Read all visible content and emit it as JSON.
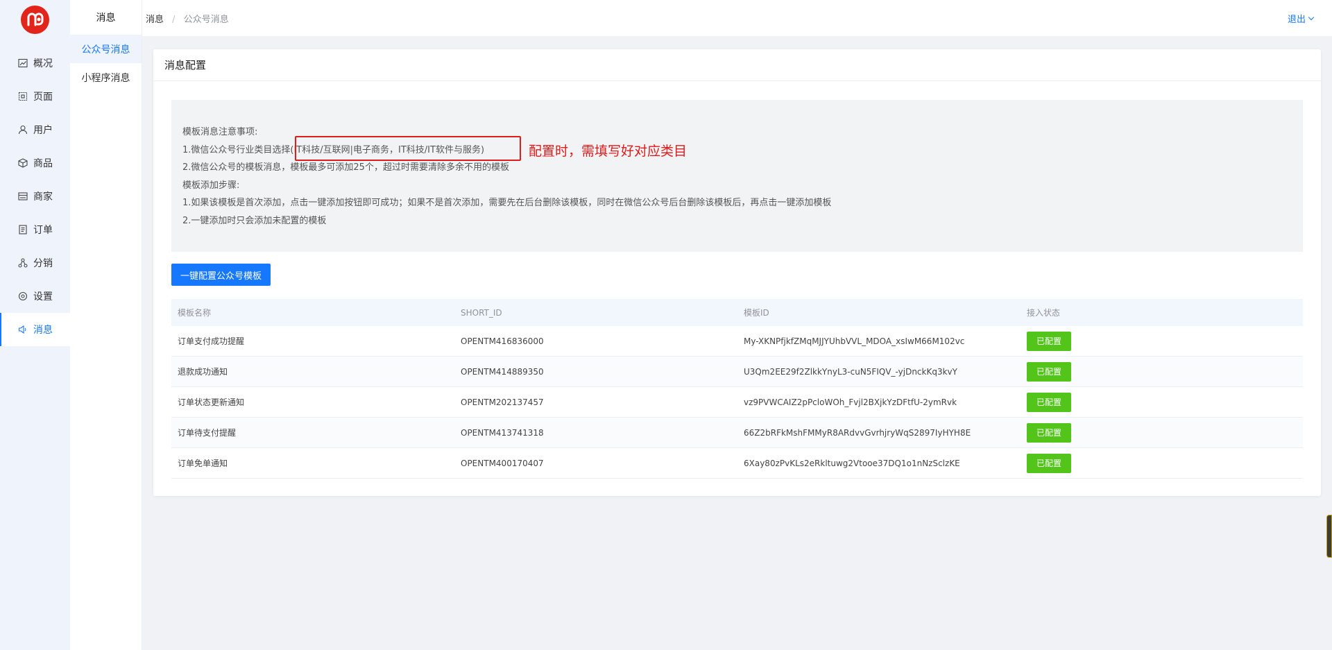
{
  "sidebar": {
    "items": [
      {
        "label": "概况",
        "icon": "chart-icon"
      },
      {
        "label": "页面",
        "icon": "page-icon"
      },
      {
        "label": "用户",
        "icon": "user-icon"
      },
      {
        "label": "商品",
        "icon": "box-icon"
      },
      {
        "label": "商家",
        "icon": "store-icon"
      },
      {
        "label": "订单",
        "icon": "order-icon"
      },
      {
        "label": "分销",
        "icon": "distribution-icon"
      },
      {
        "label": "设置",
        "icon": "settings-icon"
      },
      {
        "label": "消息",
        "icon": "message-icon"
      }
    ],
    "active_index": 8
  },
  "subsidebar": {
    "title": "消息",
    "items": [
      {
        "label": "公众号消息"
      },
      {
        "label": "小程序消息"
      }
    ]
  },
  "topbar": {
    "breadcrumb_parent": "消息",
    "breadcrumb_sep": "/",
    "breadcrumb_current": "公众号消息",
    "logout": "退出"
  },
  "card": {
    "title": "消息配置",
    "notice_lines": [
      "模板消息注意事项:",
      "1.微信公众号行业类目选择(IT科技/互联网|电子商务，IT科技/IT软件与服务)",
      "2.微信公众号的模板消息，模板最多可添加25个，超过时需要清除多余不用的模板",
      "模板添加步骤:",
      "1.如果该模板是首次添加，点击一键添加按钮即可成功；如果不是首次添加，需要先在后台删除该模板，同时在微信公众号后台删除该模板后，再点击一键添加模板",
      "2.一键添加时只会添加未配置的模板"
    ],
    "annotation": "配置时，需填写好对应类目",
    "config_button": "一键配置公众号模板"
  },
  "table": {
    "headers": [
      "模板名称",
      "SHORT_ID",
      "模板ID",
      "接入状态"
    ],
    "rows": [
      {
        "name": "订单支付成功提醒",
        "short_id": "OPENTM416836000",
        "template_id": "My-XKNPfjkfZMqMJJYUhbVVL_MDOA_xsIwM66M102vc",
        "status": "已配置"
      },
      {
        "name": "退款成功通知",
        "short_id": "OPENTM414889350",
        "template_id": "U3Qm2EE29f2ZlkkYnyL3-cuN5FIQV_-yjDnckKq3kvY",
        "status": "已配置"
      },
      {
        "name": "订单状态更新通知",
        "short_id": "OPENTM202137457",
        "template_id": "vz9PVWCAIZ2pPcloWOh_Fvjl2BXjkYzDFtfU-2ymRvk",
        "status": "已配置"
      },
      {
        "name": "订单待支付提醒",
        "short_id": "OPENTM413741318",
        "template_id": "66Z2bRFkMshFMMyR8ARdvvGvrhjryWqS2897IyHYH8E",
        "status": "已配置"
      },
      {
        "name": "订单免单通知",
        "short_id": "OPENTM400170407",
        "template_id": "6Xay80zPvKLs2eRkltuwg2Vtooe37DQ1o1nNzSclzKE",
        "status": "已配置"
      }
    ]
  },
  "colors": {
    "primary": "#1677ff",
    "success": "#52c41a",
    "annotation": "#e11a1a",
    "logo": "#e1251b"
  }
}
